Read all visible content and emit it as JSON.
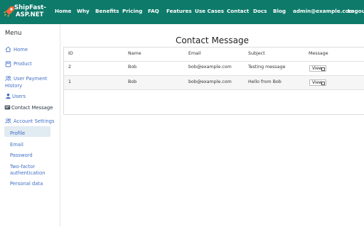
{
  "brand": {
    "line1": "ShipFast-",
    "line2": "ASP.NET"
  },
  "nav": {
    "links": [
      "Home",
      "Why",
      "Benefits",
      "Pricing",
      "FAQ",
      "Features",
      "Use Cases",
      "Contact",
      "Docs",
      "Blog",
      "admin@example.com",
      "Logout"
    ]
  },
  "sidebar": {
    "title": "Menu",
    "items": [
      {
        "label": "Home",
        "icon": "home-icon"
      },
      {
        "label": "Product",
        "icon": "product-icon"
      },
      {
        "label": "User Payment",
        "label2": "History",
        "icon": "users-icon"
      },
      {
        "label": "Users",
        "icon": "user-icon"
      },
      {
        "label": "Contact Message",
        "icon": "message-icon",
        "active": true
      },
      {
        "label": "Account Settings",
        "icon": "users-icon"
      }
    ],
    "subitems": [
      "Profile",
      "Email",
      "Password",
      "Two-factor",
      "authentication",
      "Personal data"
    ]
  },
  "main": {
    "title": "Contact Message",
    "columns": [
      "ID",
      "Name",
      "Email",
      "Subject",
      "Message"
    ],
    "rows": [
      {
        "id": "2",
        "name": "Bob",
        "email": "bob@example.com",
        "subject": "Testing message",
        "action": "View"
      },
      {
        "id": "1",
        "name": "Bob",
        "email": "bob@example.com",
        "subject": "Hello from Bob",
        "action": "View"
      }
    ]
  },
  "colors": {
    "navbar": "#0e7a6a",
    "link": "#3f6fc4",
    "active_bg": "#e1ebf2"
  }
}
